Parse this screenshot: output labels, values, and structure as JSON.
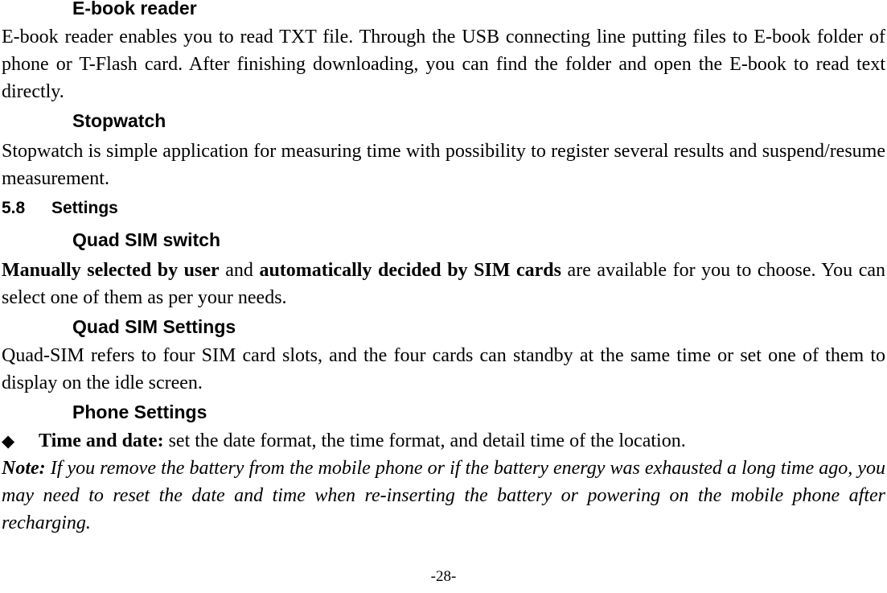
{
  "document": {
    "page_number_label": "-28-",
    "bullet_glyph": "◆"
  },
  "sections": {
    "ebook": {
      "heading": "E-book reader",
      "body": "E-book reader enables you to read TXT file. Through the USB connecting line putting files to E-book folder of phone or T-Flash card. After finishing downloading, you can find the folder and open the E-book to read text directly."
    },
    "stopwatch": {
      "heading": "Stopwatch",
      "body": "Stopwatch is simple application for measuring time with possibility to register several results and suspend/resume measurement."
    },
    "settings": {
      "number": "5.8",
      "heading": "Settings"
    },
    "quad_sim_switch": {
      "heading": "Quad SIM switch",
      "body_bold_1": "Manually selected by user",
      "body_plain_1": " and ",
      "body_bold_2": "automatically decided by SIM cards",
      "body_plain_2": " are available for you to choose. You can select one of them as per your needs."
    },
    "quad_sim_settings": {
      "heading": "Quad SIM Settings",
      "body": "Quad-SIM refers to four SIM card slots, and the four cards can standby at the same time or set one of them to display on the idle screen."
    },
    "phone_settings": {
      "heading": "Phone Settings",
      "bullet_label": "Time and date:",
      "bullet_text": " set the date format, the time format, and detail time of the location.",
      "note_lead": "Note:",
      "note_text": " If you remove the battery from the mobile phone or if the battery energy was exhausted a long time ago, you may need to reset the date and time when re-inserting the battery or powering on the mobile phone after recharging."
    }
  }
}
